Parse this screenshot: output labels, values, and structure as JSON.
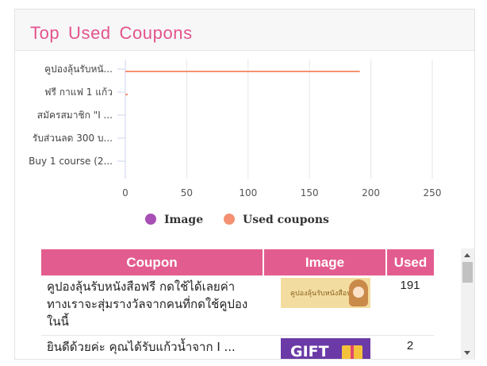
{
  "panel": {
    "title": "Top Used Coupons"
  },
  "chart_data": {
    "type": "bar",
    "orientation": "horizontal",
    "categories": [
      "คูปองลุ้นรับหนั...",
      "ฟรี กาแฟ 1 แก้ว",
      "สมัครสมาชิก \"I ...",
      "รับส่วนลด 300 บ...",
      "Buy 1 course (2..."
    ],
    "series": [
      {
        "name": "Image",
        "values": [
          0,
          0,
          0,
          0,
          0
        ]
      },
      {
        "name": "Used coupons",
        "values": [
          191,
          2,
          0,
          0,
          0
        ]
      }
    ],
    "xlim": [
      0,
      250
    ],
    "xticks": [
      "0",
      "50",
      "100",
      "150",
      "200",
      "250"
    ],
    "grid": true,
    "legend_position": "bottom",
    "colors": {
      "Image": "#a84fb5",
      "Used coupons": "#f59172"
    }
  },
  "table": {
    "headers": {
      "coupon": "Coupon",
      "image": "Image",
      "used": "Used"
    },
    "rows": [
      {
        "coupon": "คูปองลุ้นรับหนังสือฟรี กดใช้ได้เลยค่า ทางเราจะสุ่มรางวัลจากคนที่กดใช้คูปองในนี้",
        "image_text": "คูปองลุ้นรับหนังสือฟรี",
        "used": "191"
      },
      {
        "coupon": "ยินดีด้วยค่ะ คุณได้รับแก้วน้ำจาก I ...",
        "image_text": "GIFT",
        "used": "2"
      }
    ]
  },
  "colors": {
    "accent": "#e3548b",
    "table_header": "#e35c8f"
  }
}
